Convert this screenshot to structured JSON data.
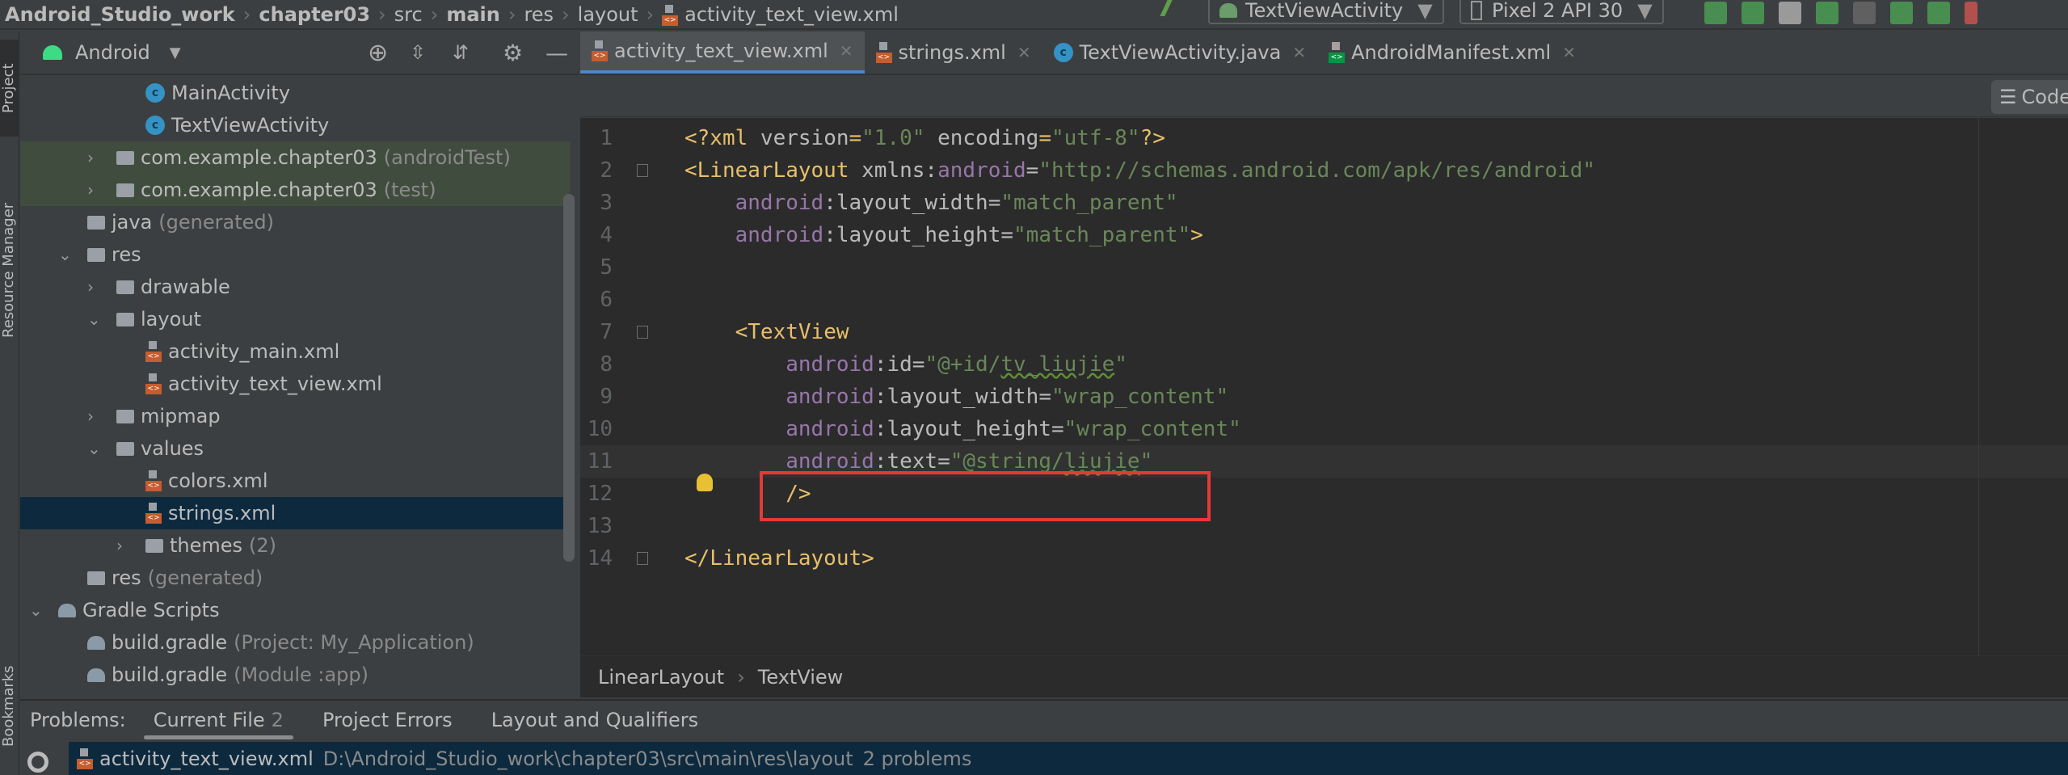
{
  "breadcrumb": [
    {
      "label": "Android_Studio_work",
      "bold": true
    },
    {
      "label": "chapter03",
      "bold": true
    },
    {
      "label": "src",
      "bold": false
    },
    {
      "label": "main",
      "bold": true
    },
    {
      "label": "res",
      "bold": false
    },
    {
      "label": "layout",
      "bold": false
    },
    {
      "label": "activity_text_view.xml",
      "bold": false,
      "icon": "xml-file-icon"
    }
  ],
  "toolbar": {
    "run_config": "TextViewActivity",
    "device": "Pixel 2 API 30",
    "icons": [
      "build-hammer-icon",
      "apply-changes-icon",
      "apply-code-changes-icon",
      "sync-icon",
      "debug-icon",
      "attach-debugger-icon",
      "profile-icon",
      "attach-icon",
      "stop-icon"
    ]
  },
  "side_tabs": {
    "project": "Project",
    "resource_manager": "Resource Manager",
    "bookmarks": "Bookmarks"
  },
  "project_panel": {
    "view": "Android",
    "icons": [
      "locate-icon",
      "expand-all-icon",
      "collapse-all-icon",
      "gear-icon",
      "minimize-icon"
    ]
  },
  "tree": [
    {
      "label": "MainActivity",
      "level": 3,
      "arrow": "",
      "icon": "class"
    },
    {
      "label": "TextViewActivity",
      "level": 3,
      "arrow": "",
      "icon": "class"
    },
    {
      "label": "com.example.chapter03",
      "extra": "(androidTest)",
      "level": 2,
      "arrow": "›",
      "icon": "folder",
      "style": "test"
    },
    {
      "label": "com.example.chapter03",
      "extra": "(test)",
      "level": 2,
      "arrow": "›",
      "icon": "folder",
      "style": "test"
    },
    {
      "label": "java",
      "extra": "(generated)",
      "level": 1,
      "arrow": "",
      "icon": "folder"
    },
    {
      "label": "res",
      "level": 1,
      "arrow": "⌄",
      "icon": "folder"
    },
    {
      "label": "drawable",
      "level": 2,
      "arrow": "›",
      "icon": "folder"
    },
    {
      "label": "layout",
      "level": 2,
      "arrow": "⌄",
      "icon": "folder"
    },
    {
      "label": "activity_main.xml",
      "level": 3,
      "arrow": "",
      "icon": "xml"
    },
    {
      "label": "activity_text_view.xml",
      "level": 3,
      "arrow": "",
      "icon": "xml"
    },
    {
      "label": "mipmap",
      "level": 2,
      "arrow": "›",
      "icon": "folder"
    },
    {
      "label": "values",
      "level": 2,
      "arrow": "⌄",
      "icon": "folder"
    },
    {
      "label": "colors.xml",
      "level": 3,
      "arrow": "",
      "icon": "xml"
    },
    {
      "label": "strings.xml",
      "level": 3,
      "arrow": "",
      "icon": "xml",
      "style": "sel"
    },
    {
      "label": "themes",
      "extra": "(2)",
      "level": 3,
      "arrow": "›",
      "icon": "folder"
    },
    {
      "label": "res",
      "extra": "(generated)",
      "level": 1,
      "arrow": "",
      "icon": "folder"
    },
    {
      "label": "Gradle Scripts",
      "level": 0,
      "arrow": "⌄",
      "icon": "gradle"
    },
    {
      "label": "build.gradle",
      "extra": "(Project: My_Application)",
      "level": 1,
      "arrow": "",
      "icon": "gradle"
    },
    {
      "label": "build.gradle",
      "extra": "(Module :app)",
      "level": 1,
      "arrow": "",
      "icon": "gradle"
    }
  ],
  "tabs": [
    {
      "label": "activity_text_view.xml",
      "icon": "xml",
      "active": true
    },
    {
      "label": "strings.xml",
      "icon": "xml"
    },
    {
      "label": "TextViewActivity.java",
      "icon": "class"
    },
    {
      "label": "AndroidManifest.xml",
      "icon": "manifest"
    }
  ],
  "code_button": "Code",
  "code": [
    {
      "n": "1",
      "t": [
        [
          "tag",
          "<?xml "
        ],
        [
          "attr",
          "version"
        ],
        [
          "tag",
          "="
        ],
        [
          "val",
          "\"1.0\""
        ],
        [
          "attr",
          " encoding"
        ],
        [
          "tag",
          "="
        ],
        [
          "val",
          "\"utf-8\""
        ],
        [
          "tag",
          "?>"
        ]
      ]
    },
    {
      "n": "2",
      "t": [
        [
          "tag",
          "<LinearLayout "
        ],
        [
          "attr",
          "xmlns:"
        ],
        [
          "ns",
          "android"
        ],
        [
          "attr",
          "="
        ],
        [
          "val",
          "\"http://schemas.android.com/apk/res/android\""
        ]
      ]
    },
    {
      "n": "3",
      "t": [
        [
          "txt",
          "    "
        ],
        [
          "ns",
          "android"
        ],
        [
          "attr",
          ":layout_width"
        ],
        [
          "attr",
          "="
        ],
        [
          "val",
          "\"match_parent\""
        ]
      ]
    },
    {
      "n": "4",
      "t": [
        [
          "txt",
          "    "
        ],
        [
          "ns",
          "android"
        ],
        [
          "attr",
          ":layout_height"
        ],
        [
          "attr",
          "="
        ],
        [
          "val",
          "\"match_parent\""
        ],
        [
          "tag",
          ">"
        ]
      ]
    },
    {
      "n": "5",
      "t": []
    },
    {
      "n": "6",
      "t": []
    },
    {
      "n": "7",
      "t": [
        [
          "txt",
          "    "
        ],
        [
          "tag",
          "<TextView"
        ]
      ]
    },
    {
      "n": "8",
      "t": [
        [
          "txt",
          "        "
        ],
        [
          "ns",
          "android"
        ],
        [
          "attr",
          ":id"
        ],
        [
          "attr",
          "="
        ],
        [
          "val",
          "\"@+id/"
        ],
        [
          "valsq",
          "tv_liujie"
        ],
        [
          "val",
          "\""
        ]
      ]
    },
    {
      "n": "9",
      "t": [
        [
          "txt",
          "        "
        ],
        [
          "ns",
          "android"
        ],
        [
          "attr",
          ":layout_width"
        ],
        [
          "attr",
          "="
        ],
        [
          "val",
          "\"wrap_content\""
        ]
      ]
    },
    {
      "n": "10",
      "t": [
        [
          "txt",
          "        "
        ],
        [
          "ns",
          "android"
        ],
        [
          "attr",
          ":layout_height"
        ],
        [
          "attr",
          "="
        ],
        [
          "val",
          "\"wrap_content\""
        ]
      ]
    },
    {
      "n": "11",
      "t": [
        [
          "txt",
          "        "
        ],
        [
          "ns",
          "android"
        ],
        [
          "attr",
          ":text"
        ],
        [
          "attr",
          "="
        ],
        [
          "val",
          "\"@string/"
        ],
        [
          "valsq",
          "liujie"
        ],
        [
          "val",
          "\""
        ]
      ],
      "current": true
    },
    {
      "n": "12",
      "t": [
        [
          "txt",
          "        "
        ],
        [
          "tag",
          "/>"
        ]
      ]
    },
    {
      "n": "13",
      "t": []
    },
    {
      "n": "14",
      "t": [
        [
          "tag",
          "</LinearLayout>"
        ]
      ]
    }
  ],
  "editor_breadcrumb": [
    "LinearLayout",
    "TextView"
  ],
  "problems": {
    "label": "Problems:",
    "tabs": [
      {
        "label": "Current File",
        "count": "2",
        "active": true
      },
      {
        "label": "Project Errors"
      },
      {
        "label": "Layout and Qualifiers"
      }
    ],
    "row": {
      "file": "activity_text_view.xml",
      "path": "D:\\Android_Studio_work\\chapter03\\src\\main\\res\\layout",
      "count": "2 problems"
    }
  }
}
